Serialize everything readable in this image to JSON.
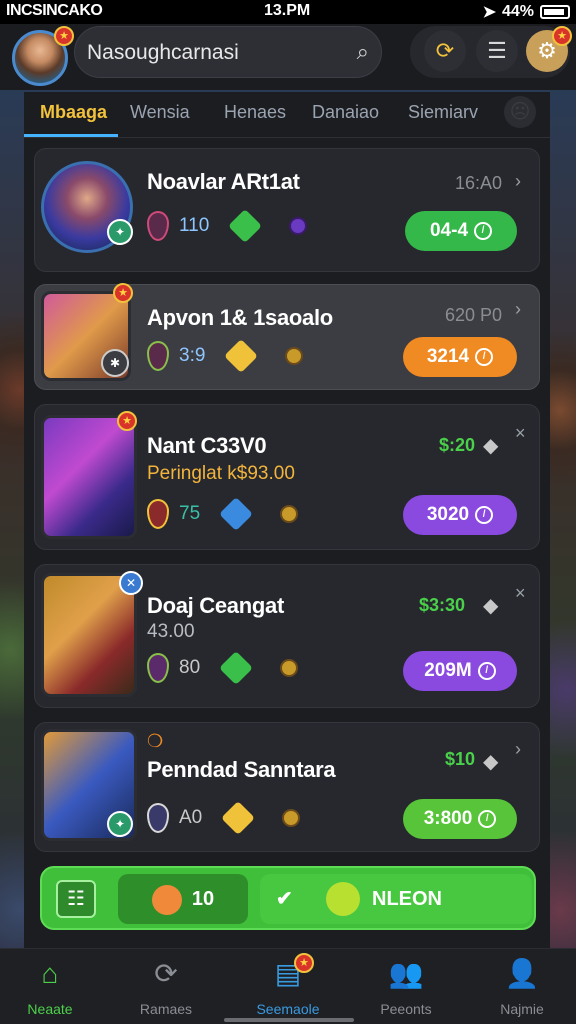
{
  "status": {
    "left": "INCSINCAKO",
    "time": "13.PM",
    "battery": "44%"
  },
  "header": {
    "search_text": "Nasoughcarnasi",
    "search_icon": "search-icon",
    "icons": [
      "refresh-icon",
      "list-icon",
      "settings-icon"
    ]
  },
  "tabs": [
    {
      "label": "Mbaaga",
      "active": true
    },
    {
      "label": "Wensia",
      "active": false
    },
    {
      "label": "Henaes",
      "active": false
    },
    {
      "label": "Danaiao",
      "active": false
    },
    {
      "label": "Siemiarv",
      "active": false
    }
  ],
  "cards": [
    {
      "name": "Noavlar ARt1at",
      "value": "16:A0",
      "stat": "110",
      "button": "04-4",
      "button_color": "#35b84a"
    },
    {
      "name": "Apvon 1& 1saoalo",
      "value": "620 P0",
      "stat": "3:9",
      "button": "3214",
      "button_color": "#f08a22"
    },
    {
      "name": "Nant C33V0",
      "subtitle": "Peringlat k$93.00",
      "value": "$:20",
      "stat": "75",
      "button": "3020",
      "button_color": "#8a4ae0"
    },
    {
      "name": "Doaj Ceangat",
      "subtitle": "43.00",
      "value": "$3:30",
      "stat": "80",
      "button": "209M",
      "button_color": "#8a4ae0"
    },
    {
      "name": "Penndad Sanntara",
      "value": "$10",
      "stat": "A0",
      "button": "3:800",
      "button_color": "#58c43a"
    }
  ],
  "actionbar": {
    "count": "10",
    "confirm_label": "NLEON"
  },
  "nav": [
    {
      "label": "Neaate",
      "icon": "home-icon",
      "active": true
    },
    {
      "label": "Ramaes",
      "icon": "refresh-icon",
      "active": false
    },
    {
      "label": "Seemaole",
      "icon": "chat-icon",
      "active": false
    },
    {
      "label": "Peeonts",
      "icon": "people-icon",
      "active": false
    },
    {
      "label": "Najmie",
      "icon": "profile-icon",
      "active": false
    }
  ]
}
